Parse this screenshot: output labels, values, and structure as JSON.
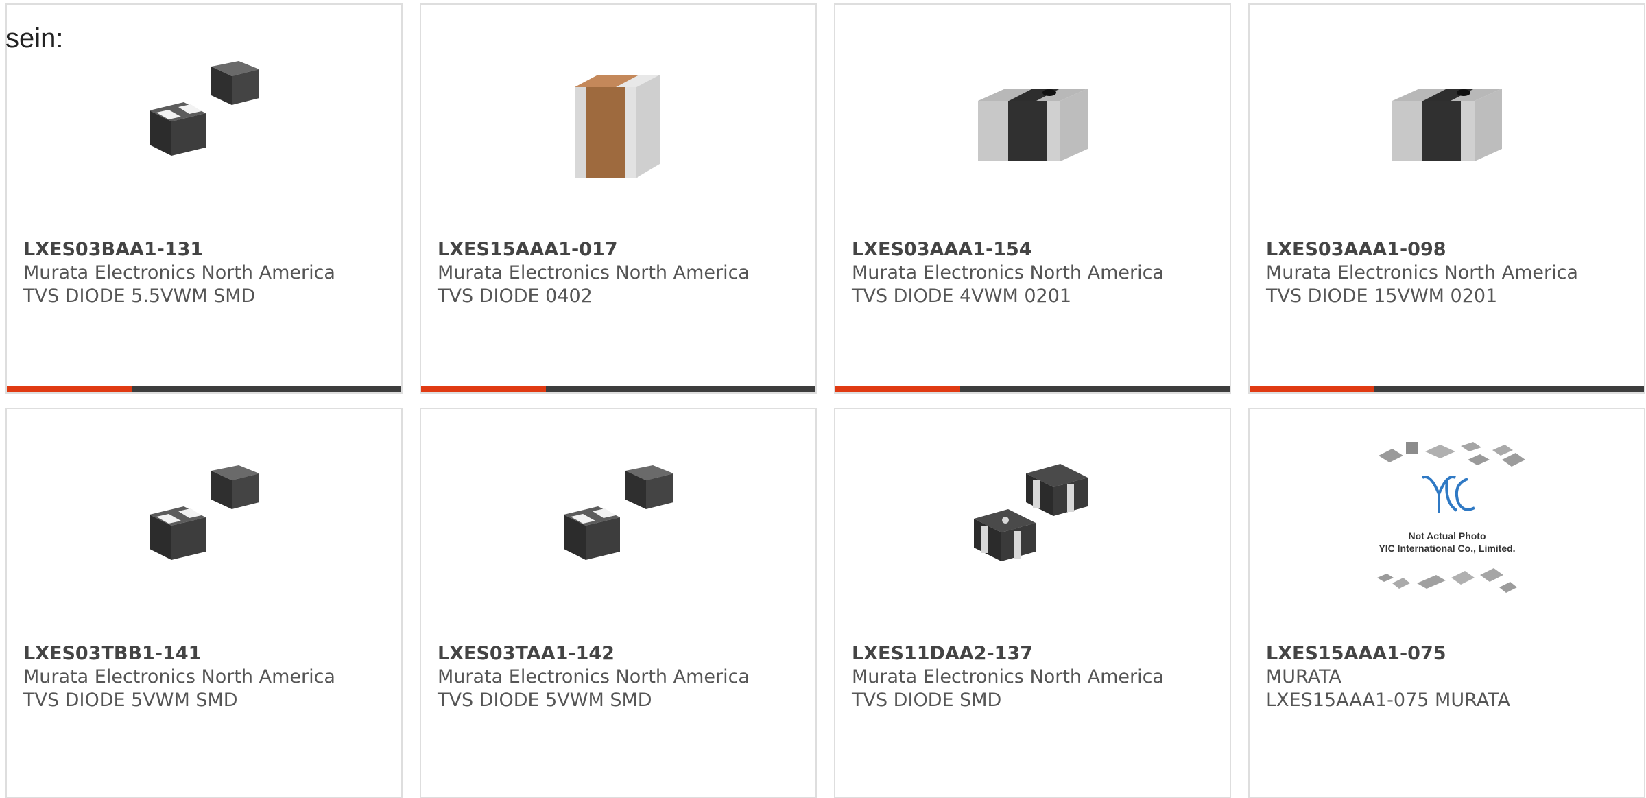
{
  "intro_text": "sein:",
  "colors": {
    "accent": "#e03a12",
    "bar": "#3d3d3d",
    "border": "#dedede"
  },
  "products": [
    {
      "part": "LXES03BAA1-131",
      "manufacturer": "Murata Electronics North America",
      "description": "TVS DIODE 5.5VWM SMD",
      "image": "two-block-chip-image"
    },
    {
      "part": "LXES15AAA1-017",
      "manufacturer": "Murata Electronics North America",
      "description": "TVS DIODE 0402",
      "image": "brown-capacitor-chip-image"
    },
    {
      "part": "LXES03AAA1-154",
      "manufacturer": "Murata Electronics North America",
      "description": "TVS DIODE 4VWM 0201",
      "image": "dark-chip-silver-ends-image"
    },
    {
      "part": "LXES03AAA1-098",
      "manufacturer": "Murata Electronics North America",
      "description": "TVS DIODE 15VWM 0201",
      "image": "dark-chip-silver-ends-image"
    },
    {
      "part": "LXES03TBB1-141",
      "manufacturer": "Murata Electronics North America",
      "description": "TVS DIODE 5VWM SMD",
      "image": "two-block-chip-image"
    },
    {
      "part": "LXES03TAA1-142",
      "manufacturer": "Murata Electronics North America",
      "description": "TVS DIODE 5VWM SMD",
      "image": "two-block-chip-image"
    },
    {
      "part": "LXES11DAA2-137",
      "manufacturer": "Murata Electronics North America",
      "description": "TVS DIODE SMD",
      "image": "quad-terminal-chip-image"
    },
    {
      "part": "LXES15AAA1-075",
      "manufacturer": "MURATA",
      "description": "LXES15AAA1-075 MURATA",
      "image": "not-actual-photo-placeholder-image",
      "placeholder_line1": "Not Actual Photo",
      "placeholder_line2": "YIC International Co., Limited."
    }
  ]
}
